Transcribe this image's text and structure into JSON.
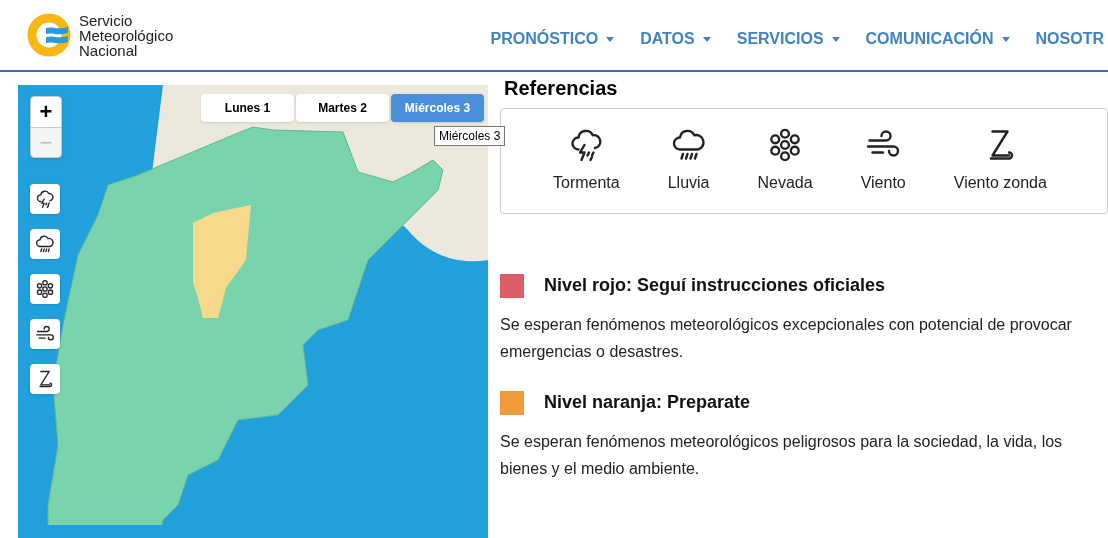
{
  "logo": {
    "lines": [
      "Servicio",
      "Meteorológico",
      "Nacional"
    ]
  },
  "nav": [
    {
      "label": "PRONÓSTICO",
      "dropdown": true
    },
    {
      "label": "DATOS",
      "dropdown": true
    },
    {
      "label": "SERVICIOS",
      "dropdown": true
    },
    {
      "label": "COMUNICACIÓN",
      "dropdown": true
    },
    {
      "label": "NOSOTR",
      "dropdown": false
    }
  ],
  "map": {
    "zoom": [
      {
        "label": "+",
        "disabled": false
      },
      {
        "label": "−",
        "disabled": true
      }
    ],
    "layers": [
      {
        "kind": "storm"
      },
      {
        "kind": "rain"
      },
      {
        "kind": "snow"
      },
      {
        "kind": "wind"
      },
      {
        "kind": "zonda"
      }
    ],
    "days": [
      {
        "label": "Lunes 1",
        "selected": false
      },
      {
        "label": "Martes 2",
        "selected": false
      },
      {
        "label": "Miércoles 3",
        "selected": true
      }
    ],
    "tooltip": "Miércoles 3"
  },
  "references": {
    "title": "Referencias",
    "items": [
      {
        "kind": "storm",
        "label": "Tormenta"
      },
      {
        "kind": "rain",
        "label": "Lluvia"
      },
      {
        "kind": "snow",
        "label": "Nevada"
      },
      {
        "kind": "wind",
        "label": "Viento"
      },
      {
        "kind": "zonda",
        "label": "Viento zonda"
      }
    ]
  },
  "levels": [
    {
      "color": "#dc5c68",
      "title": "Nivel rojo: Seguí instrucciones oficiales",
      "description": "Se esperan fenómenos meteorológicos excepcionales con potencial de provocar emergencias o desastres."
    },
    {
      "color": "#f39a3e",
      "title": "Nivel naranja: Preparate",
      "description": "Se esperan fenómenos meteorológicos peligrosos para la sociedad, la vida, los bienes y el medio ambiente."
    }
  ]
}
